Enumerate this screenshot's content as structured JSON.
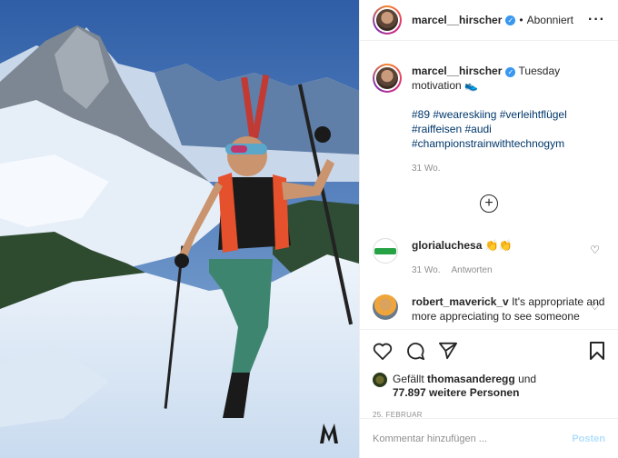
{
  "post": {
    "username": "marcel__hirscher",
    "follow_status": "Abonniert",
    "more_icon": "more-horizontal-icon"
  },
  "caption": {
    "username": "marcel__hirscher",
    "text": "Tuesday motivation 👟",
    "hashtags": "#89 #weareskiing #verleihtflügel #raiffeisen #audi #championstrainwithtechnogym",
    "time": "31 Wo."
  },
  "comments": [
    {
      "username": "gloriaLuchesa",
      "display": "glorialuchesa",
      "text": "👏👏",
      "time": "31 Wo.",
      "reply_label": "Antworten"
    },
    {
      "username": "robert_maverick_v",
      "display": "robert_maverick_v",
      "text": "It's appropriate and more appreciating to see someone"
    }
  ],
  "likes": {
    "prefix": "Gefällt",
    "user": "thomasanderegg",
    "connector": "und",
    "count_text": "77.897 weitere Personen"
  },
  "date": "25. FEBRUAR",
  "comment_input": {
    "placeholder": "Kommentar hinzufügen ...",
    "post_label": "Posten"
  },
  "colors": {
    "link": "#00376b",
    "verified": "#3897f0",
    "post_disabled": "#b2dffc"
  }
}
